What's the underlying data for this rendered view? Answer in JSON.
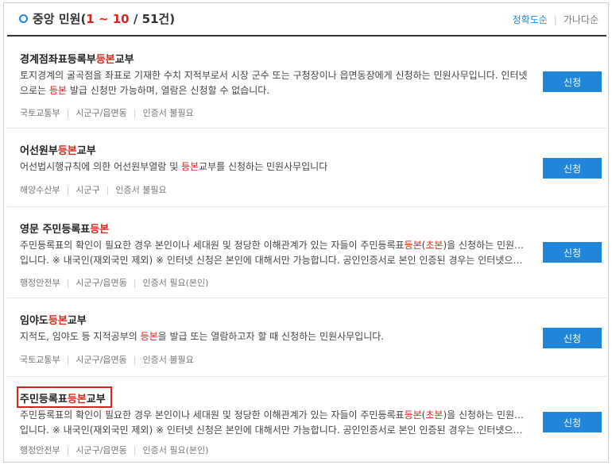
{
  "header": {
    "title_main": "중앙 민원",
    "open_paren": "(",
    "range": "1 ~ 10",
    "slash": " / ",
    "total": "51건",
    "close_paren": ")",
    "sort_accuracy": "정확도순",
    "sort_alpha": "가나다순"
  },
  "items": [
    {
      "title_pre": "경계점좌표등록부",
      "title_hl": "등본",
      "title_post": "교부",
      "desc1": "토지경계의 굴곡점을 좌표로 기재한 수치 지적부로서 시장 군수 또는 구청장이나 읍면동장에게 신청하는 민원사무입니다. 인터넷",
      "desc2_pre": "으로는 ",
      "desc2_hl": "등본",
      "desc2_post": " 발급 신청만 가능하며, 열람은 신청할 수 없습니다.",
      "meta": [
        "국토교통부",
        "시군구/읍면동",
        "인증서 불필요"
      ],
      "button": "신청"
    },
    {
      "title_pre": "어선원부",
      "title_hl": "등본",
      "title_post": "교부",
      "desc1_pre": "어선법시행규칙에 의한 어선원부열람 및 ",
      "desc1_hl": "등본",
      "desc1_post": "교부를 신청하는 민원사무입니다",
      "meta": [
        "해양수산부",
        "시군구",
        "인증서 불필요"
      ],
      "button": "신청"
    },
    {
      "title_pre": "영문 주민등록표",
      "title_hl": "등본",
      "desc1_pre": "주민등록표의 확인이 필요한 경우 본인이나 세대원 및 정당한 이해관계가 있는 자들이 주민등록표",
      "desc1_hl": "등본",
      "desc1_mid": "(",
      "desc1_hl2": "초본",
      "desc1_post": ")을 신청하는 민원사무",
      "desc2": "입니다. ※ 내국인(재외국민 제외) ※ 인터넷 신청은 본인에 대해서만 가능합니다. 공인인증서로 본인 인증된 경우는 인터넷으로 ...",
      "meta": [
        "행정안전부",
        "시군구/읍면동",
        "인증서 필요(본인)"
      ],
      "button": "신청"
    },
    {
      "title_pre": "임야도",
      "title_hl": "등본",
      "title_post": "교부",
      "desc1_pre": "지적도, 임야도 등 지적공부의 ",
      "desc1_hl": "등본",
      "desc1_post": "을 발급 또는 열람하고자 할 때 신청하는 민원사무입니다.",
      "meta": [
        "국토교통부",
        "시군구/읍면동",
        "인증서 불필요"
      ],
      "button": "신청"
    },
    {
      "title_pre": "주민등록표",
      "title_hl": "등본",
      "title_post": "교부",
      "desc1_pre": "주민등록표의 확인이 필요한 경우 본인이나 세대원 및 정당한 이해관계가 있는 자들이 주민등록표",
      "desc1_hl": "등본",
      "desc1_mid": "(",
      "desc1_hl2": "초본",
      "desc1_post": ")을 신청하는 민원사무",
      "desc2": "입니다. ※ 내국인(재외국민 제외) ※ 인터넷 신청은 본인에 대해서만 가능합니다. 공인인증서로 본인 인증된 경우는 인터넷으로 ...",
      "meta": [
        "행정안전부",
        "시군구/읍면동",
        "인증서 필요(본인)"
      ],
      "button": "신청"
    }
  ]
}
